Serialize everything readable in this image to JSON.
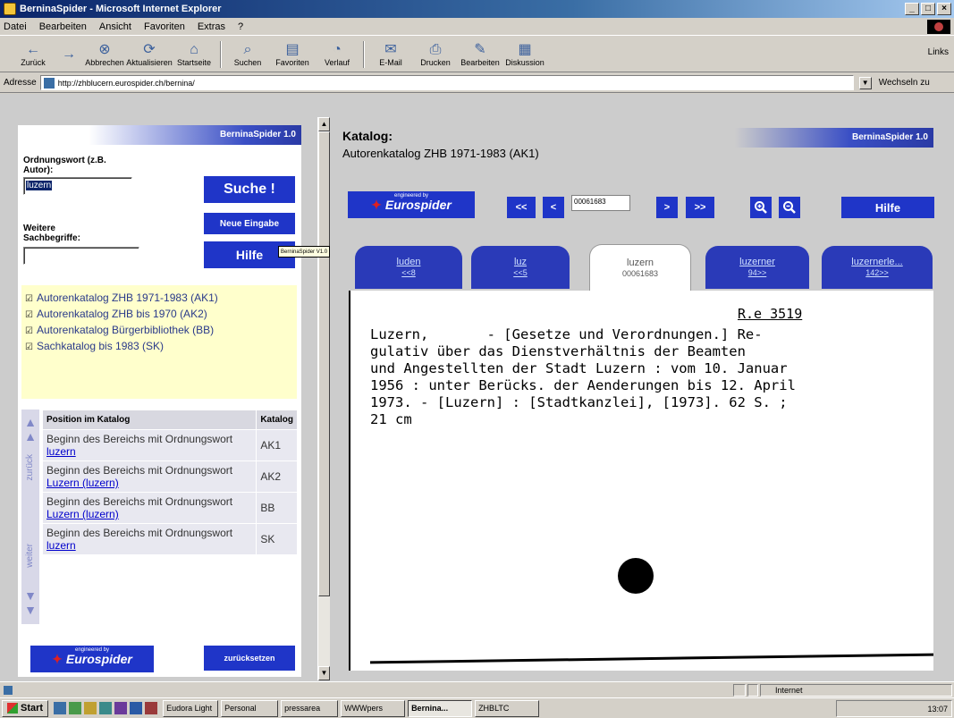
{
  "window": {
    "title": "BerninaSpider - Microsoft Internet Explorer",
    "buttons": [
      "_",
      "□",
      "×"
    ]
  },
  "menu": [
    "Datei",
    "Bearbeiten",
    "Ansicht",
    "Favoriten",
    "Extras",
    "?"
  ],
  "toolbar": {
    "back": "Zurück",
    "forward": "",
    "stop": "Abbrechen",
    "refresh": "Aktualisieren",
    "home": "Startseite",
    "search": "Suchen",
    "favorites": "Favoriten",
    "history": "Verlauf",
    "mail": "E-Mail",
    "print": "Drucken",
    "edit": "Bearbeiten",
    "discuss": "Diskussion",
    "links": "Links"
  },
  "address": {
    "label": "Adresse",
    "url": "http://zhblucern.eurospider.ch/bernina/",
    "go": "Wechseln zu"
  },
  "left": {
    "brand": "BerninaSpider 1.0",
    "field1_label_line1": "Ordnungswort (z.B.",
    "field1_label_line2": "Autor):",
    "field1_value": "luzern",
    "search_button": "Suche !",
    "new_button": "Neue Eingabe",
    "field2_label_line1": "Weitere",
    "field2_label_line2": "Sachbegriffe:",
    "field2_value": "",
    "help_button": "Hilfe",
    "catalogs": [
      "Autorenkatalog ZHB 1971-1983 (AK1)",
      "Autorenkatalog ZHB bis 1970 (AK2)",
      "Autorenkatalog Bürgerbibliothek (BB)",
      "Sachkatalog bis 1983 (SK)"
    ],
    "nav_back": "zurück",
    "nav_forward": "weiter",
    "table": {
      "col_position": "Position im Katalog",
      "col_catalog": "Katalog",
      "rows": [
        {
          "text": "Beginn des Bereichs mit Ordnungswort ",
          "link": "luzern",
          "catalog": "AK1"
        },
        {
          "text": "Beginn des Bereichs mit Ordnungswort ",
          "link": "Luzern (luzern)",
          "catalog": "AK2"
        },
        {
          "text": "Beginn des Bereichs mit Ordnungswort ",
          "link": "Luzern (luzern)",
          "catalog": "BB"
        },
        {
          "text": "Beginn des Bereichs mit Ordnungswort ",
          "link": "luzern",
          "catalog": "SK"
        }
      ]
    },
    "logo_engineered": "engineered by",
    "logo_name": "Eurospider",
    "reset_button": "zurücksetzen"
  },
  "right": {
    "title": "Katalog:",
    "subtitle": "Autorenkatalog ZHB 1971-1983 (AK1)",
    "brand": "BerninaSpider 1.0",
    "tooltip": "BerninaSpider V1.0",
    "logo_engineered": "engineered by",
    "logo_name": "Eurospider",
    "nav_first": "<<",
    "nav_prev": "<",
    "card_number": "00061683",
    "nav_next": ">",
    "nav_last": ">>",
    "help_button": "Hilfe",
    "tabs": [
      {
        "label": "luden",
        "sub": "<<8"
      },
      {
        "label": "luz",
        "sub": "<<5"
      },
      {
        "label": "luzern",
        "sub": "00061683"
      },
      {
        "label": "luzerner",
        "sub": "94>>"
      },
      {
        "label": "luzernerle...",
        "sub": "142>>"
      }
    ],
    "card": {
      "signature": "R.e 3519",
      "lines": [
        "Luzern,       - [Gesetze und Verordnungen.] Re-",
        "gulativ über das Dienstverhältnis der Beamten",
        "und Angestellten der Stadt Luzern : vom 10. Januar",
        "1956 : unter Berücks. der Aenderungen bis 12. April",
        "1973. - [Luzern] : [Stadtkanzlei], [1973]. 62 S. ;",
        "21 cm"
      ]
    }
  },
  "status": {
    "zone": "Internet"
  },
  "taskbar": {
    "start": "Start",
    "tasks": [
      "Eudora Light",
      "Personal",
      "pressarea",
      "WWWpers",
      "Bernina...",
      "ZHBLTC"
    ],
    "active_task": "Bernina...",
    "clock": "13:07"
  }
}
